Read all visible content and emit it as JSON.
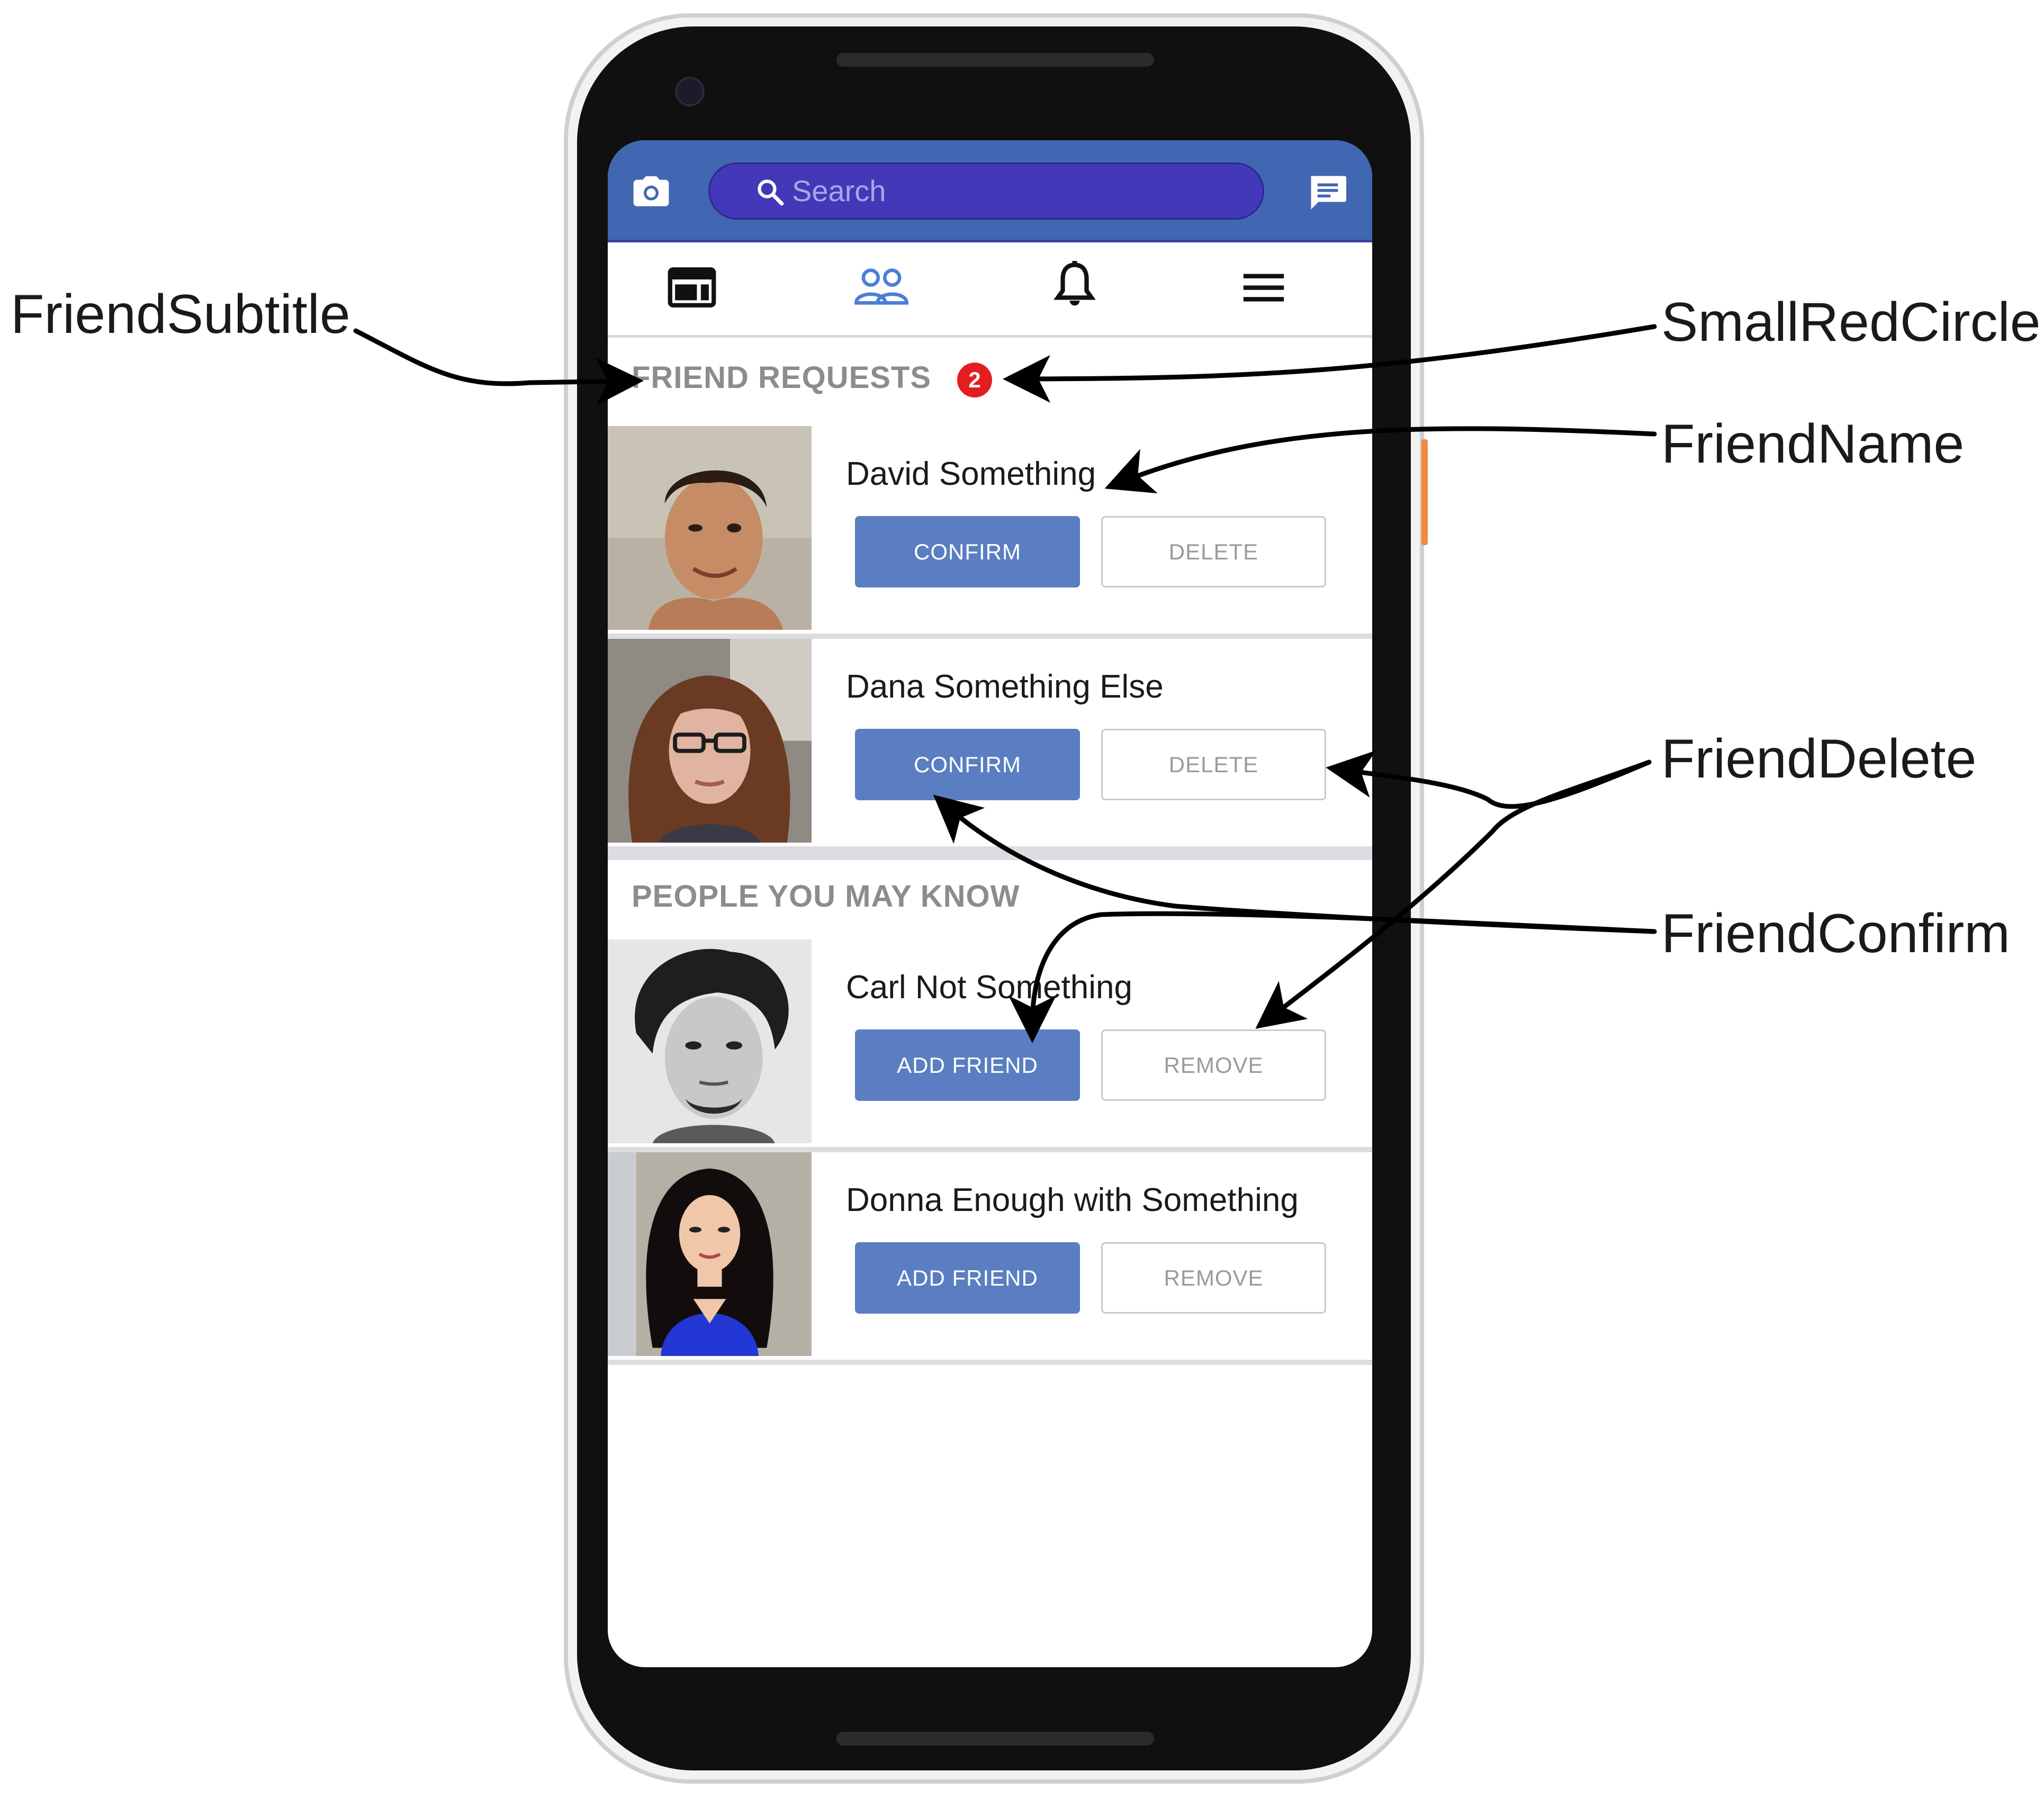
{
  "app": {
    "search": {
      "placeholder": "Search"
    },
    "icons": {
      "camera": "camera-icon",
      "search": "search-icon",
      "messenger": "messenger-icon",
      "news_feed": "news-feed-icon",
      "friends": "friends-icon",
      "notifications": "bell-icon",
      "menu": "hamburger-menu-icon"
    },
    "active_tab": "friends",
    "colors": {
      "brand": "#4267b2",
      "search_pill": "#4338b8",
      "button_primary": "#5a7ec1",
      "badge_red": "#e41e1e",
      "active_tab_icon": "#4a7fd6"
    },
    "friend_requests": {
      "title": "FRIEND REQUESTS",
      "badge_count": "2",
      "items": [
        {
          "name": "David Something",
          "confirm_label": "CONFIRM",
          "delete_label": "DELETE"
        },
        {
          "name": "Dana Something Else",
          "confirm_label": "CONFIRM",
          "delete_label": "DELETE"
        }
      ]
    },
    "people_you_may_know": {
      "title": "PEOPLE YOU MAY KNOW",
      "items": [
        {
          "name": "Carl Not Something",
          "add_label": "ADD FRIEND",
          "remove_label": "REMOVE"
        },
        {
          "name": "Donna Enough with Something",
          "add_label": "ADD FRIEND",
          "remove_label": "REMOVE"
        }
      ]
    }
  },
  "annotations": {
    "friend_subtitle": "FriendSubtitle",
    "small_red_circle": "SmallRedCircle",
    "friend_name": "FriendName",
    "friend_delete": "FriendDelete",
    "friend_confirm": "FriendConfirm"
  }
}
